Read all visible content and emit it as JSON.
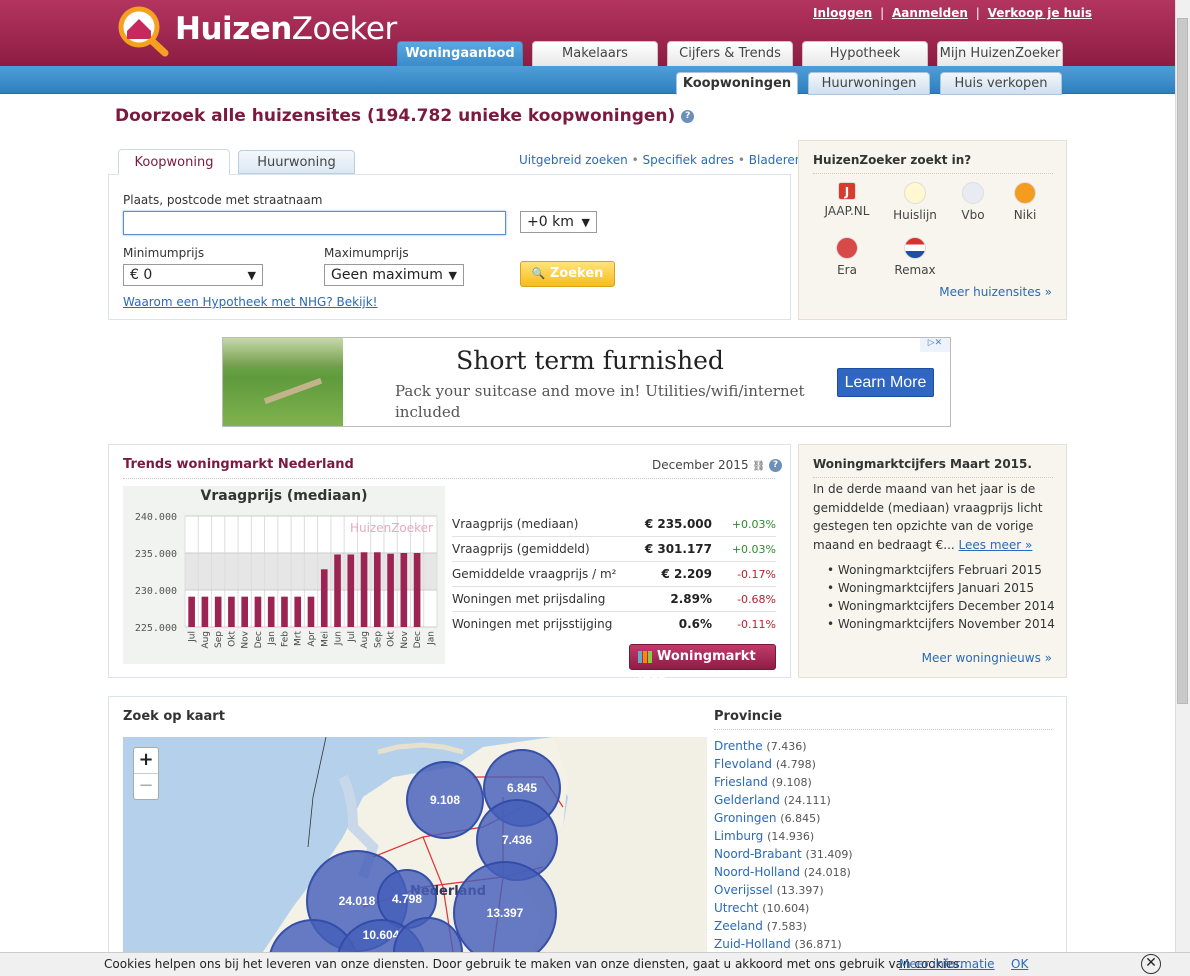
{
  "header": {
    "logo_bold": "Huizen",
    "logo_light": "Zoeker",
    "links": [
      "Inloggen",
      "Aanmelden",
      "Verkoop je huis"
    ],
    "tabs": [
      "Woningaanbod",
      "Makelaars",
      "Cijfers & Trends",
      "Hypotheek",
      "Mijn HuizenZoeker"
    ],
    "subtabs": [
      "Koopwoningen",
      "Huurwoningen",
      "Huis verkopen"
    ]
  },
  "page_title": "Doorzoek alle huizensites (194.782 unieke koopwoningen)",
  "search": {
    "tabs": [
      "Koopwoning",
      "Huurwoning"
    ],
    "links": [
      "Uitgebreid zoeken",
      "Specifiek adres",
      "Bladeren"
    ],
    "place_label": "Plaats, postcode met straatnaam",
    "radius": "+0 km",
    "min_label": "Minimumprijs",
    "max_label": "Maximumprijs",
    "min_value": "€ 0",
    "max_value": "Geen maximum",
    "button": "Zoeken",
    "nhg_link": "Waarom een Hypotheek met NHG? Bekijk!"
  },
  "sites": {
    "title": "HuizenZoeker zoekt in?",
    "items": [
      "JAAP.NL",
      "Huislijn",
      "Vbo",
      "Niki",
      "Era",
      "Remax"
    ],
    "more": "Meer huizensites »"
  },
  "ad": {
    "title": "Short term furnished",
    "text": "Pack your suitcase and move in! Utilities/wifi/internet included",
    "button": "Learn More"
  },
  "trends": {
    "title": "Trends woningmarkt Nederland",
    "date": "December 2015",
    "chart_title": "Vraagprijs (mediaan)",
    "chart_watermark": "HuizenZoeker",
    "rows": [
      {
        "label": "Vraagprijs (mediaan)",
        "value": "€ 235.000",
        "delta": "+0.03%"
      },
      {
        "label": "Vraagprijs (gemiddeld)",
        "value": "€ 301.177",
        "delta": "+0.03%"
      },
      {
        "label": "Gemiddelde vraagprijs / m²",
        "value": "€ 2.209",
        "delta": "-0.17%"
      },
      {
        "label": "Woningen met prijsdaling",
        "value": "2.89%",
        "delta": "-0.68%"
      },
      {
        "label": "Woningen met prijsstijging",
        "value": "0.6%",
        "delta": "-0.11%"
      }
    ],
    "button": "Woningmarkt info"
  },
  "chart_data": {
    "type": "bar",
    "title": "Vraagprijs (mediaan)",
    "categories": [
      "Jul",
      "Aug",
      "Sep",
      "Okt",
      "Nov",
      "Dec",
      "Jan",
      "Feb",
      "Mrt",
      "Apr",
      "Mei",
      "Jun",
      "Jul",
      "Aug",
      "Sep",
      "Okt",
      "Nov",
      "Dec",
      "Jan"
    ],
    "values": [
      229.1,
      229.1,
      229.1,
      229.1,
      229.1,
      229.1,
      229.1,
      229.1,
      229.1,
      229.1,
      232.8,
      234.8,
      234.8,
      235.1,
      235.1,
      234.9,
      235.0,
      235.0,
      0
    ],
    "yticks": [
      "240.000",
      "235.000",
      "230.000",
      "225.000"
    ],
    "ylim": [
      225,
      240
    ]
  },
  "news": {
    "title": "Woningmarktcijfers Maart 2015.",
    "text": "In de derde maand van het jaar is de gemiddelde (mediaan) vraagprijs licht gestegen ten opzichte van de vorige maand en bedraagt €...",
    "read_more": "Lees meer »",
    "items": [
      "Woningmarktcijfers Februari 2015",
      "Woningmarktcijfers Januari 2015",
      "Woningmarktcijfers December 2014",
      "Woningmarktcijfers November 2014"
    ],
    "more": "Meer woningnieuws »"
  },
  "map": {
    "title": "Zoek op kaart",
    "zoom_in": "+",
    "zoom_out": "−",
    "country_label": "Nederland",
    "clusters": [
      "9.108",
      "6.845",
      "7.436",
      "24.018",
      "4.798",
      "13.397",
      "10.604"
    ]
  },
  "provinces": {
    "title": "Provincie",
    "items": [
      {
        "name": "Drenthe",
        "count": "(7.436)"
      },
      {
        "name": "Flevoland",
        "count": "(4.798)"
      },
      {
        "name": "Friesland",
        "count": "(9.108)"
      },
      {
        "name": "Gelderland",
        "count": "(24.111)"
      },
      {
        "name": "Groningen",
        "count": "(6.845)"
      },
      {
        "name": "Limburg",
        "count": "(14.936)"
      },
      {
        "name": "Noord-Brabant",
        "count": "(31.409)"
      },
      {
        "name": "Noord-Holland",
        "count": "(24.018)"
      },
      {
        "name": "Overijssel",
        "count": "(13.397)"
      },
      {
        "name": "Utrecht",
        "count": "(10.604)"
      },
      {
        "name": "Zeeland",
        "count": "(7.583)"
      },
      {
        "name": "Zuid-Holland",
        "count": "(36.871)"
      }
    ]
  },
  "cookie": {
    "text": "Cookies helpen ons bij het leveren van onze diensten. Door gebruik te maken van onze diensten, gaat u akkoord met ons gebruik van cookies.",
    "more": "Meer informatie",
    "ok": "OK"
  }
}
